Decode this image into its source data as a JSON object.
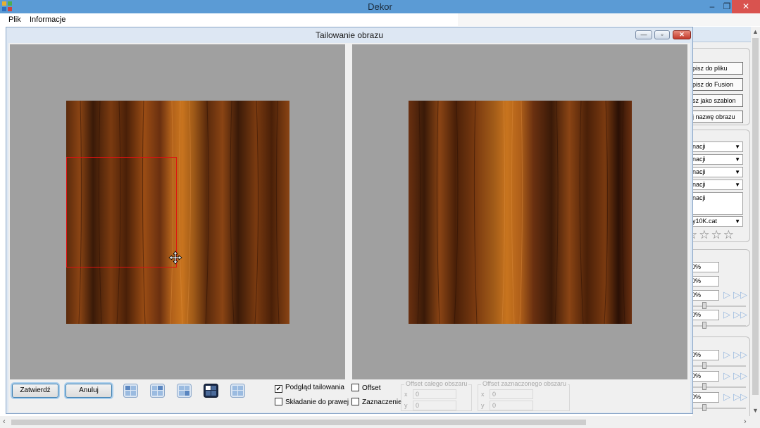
{
  "app": {
    "title": "Dekor",
    "menu": [
      "Plik",
      "Informacje"
    ],
    "window_buttons": {
      "minimize": "–",
      "restore": "❐",
      "close": "✕"
    }
  },
  "dialog": {
    "title": "Tailowanie obrazu",
    "window_buttons": {
      "minimize": "—",
      "restore": "▫",
      "close": "✕"
    },
    "buttons": {
      "confirm": "Zatwierdź",
      "cancel": "Anuluj"
    },
    "tile_modes": [
      {
        "icon": "tile-mode-1-icon",
        "active": false
      },
      {
        "icon": "tile-mode-2-icon",
        "active": false
      },
      {
        "icon": "tile-mode-3-icon",
        "active": false
      },
      {
        "icon": "tile-mode-4-icon",
        "active": true
      },
      {
        "icon": "tile-mode-5-icon",
        "active": false
      }
    ],
    "checkboxes": {
      "preview": {
        "label": "Podgląd tailowania",
        "checked": true
      },
      "fold_right": {
        "label": "Składanie do prawej",
        "checked": false
      },
      "offset": {
        "label": "Offset",
        "checked": false
      },
      "selection": {
        "label": "Zaznaczenie",
        "checked": false
      }
    },
    "offset_whole": {
      "title": "Offset całego obszaru",
      "x_label": "x",
      "x": "0",
      "y_label": "y",
      "y": "0"
    },
    "offset_selected": {
      "title": "Offset zaznaczonego obszaru",
      "x_label": "x",
      "x": "0",
      "y_label": "y",
      "y": "0"
    }
  },
  "right_panel": {
    "buttons": [
      "pisz do pliku",
      "pisz do Fusion",
      "sz jako szablon",
      "j nazwę obrazu"
    ],
    "selects": [
      "nacji",
      "nacji",
      "nacji",
      "nacji"
    ],
    "textbox": "nacji",
    "catalog_select": "y10K.cat",
    "stars": "☆☆☆☆",
    "percent_fields": [
      "0%",
      "0%",
      "0%",
      "0%",
      "0%",
      "0%",
      "0%"
    ]
  },
  "colors": {
    "titlebar": "#5b9bd5",
    "close_button": "#d9534f",
    "dialog_frame": "#dde7f3",
    "preview_bg": "#a0a0a0",
    "selection_rect": "#e01010",
    "wood_dark": "#3a1a08",
    "wood_light": "#c8741e"
  }
}
